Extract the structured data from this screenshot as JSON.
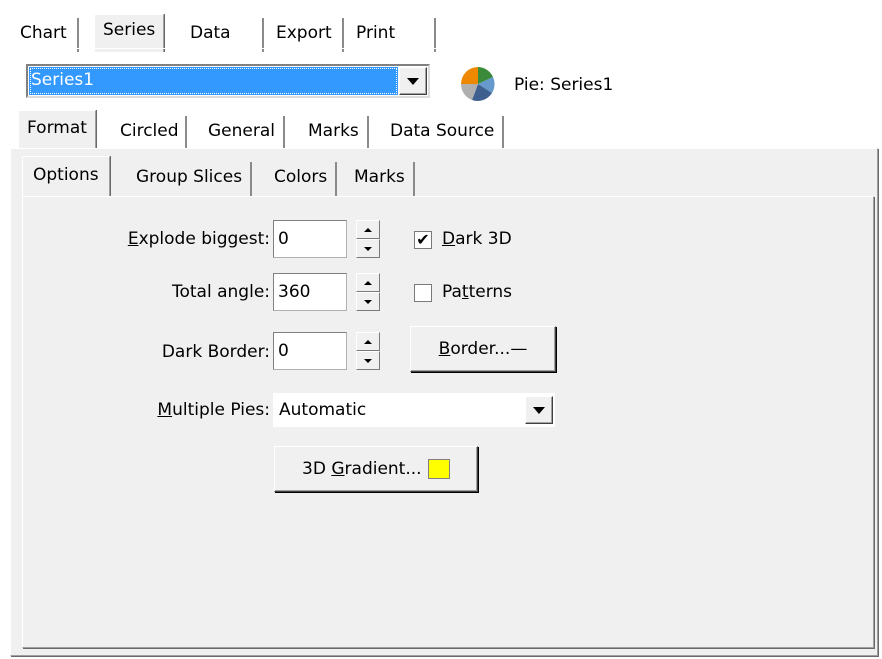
{
  "top_tabs": [
    "Chart",
    "Series",
    "Data",
    "Export",
    "Print"
  ],
  "active_top_tab": "Series",
  "series_select": {
    "value": "Series1"
  },
  "series_info": {
    "label": "Pie: Series1",
    "icon": "pie-chart-icon"
  },
  "series_tabs": [
    "Format",
    "Circled",
    "General",
    "Marks",
    "Data Source"
  ],
  "active_series_tab": "Format",
  "format_tabs": [
    "Options",
    "Group Slices",
    "Colors",
    "Marks"
  ],
  "active_format_tab": "Options",
  "options": {
    "explode_biggest": {
      "label_pre": "",
      "label_ul": "E",
      "label_post": "xplode biggest:",
      "value": "0"
    },
    "total_angle": {
      "label": "Total angle:",
      "value": "360"
    },
    "dark_border": {
      "label": "Dark Border:",
      "value": "0"
    },
    "dark_3d": {
      "label_pre": "",
      "label_ul": "D",
      "label_post": "ark 3D",
      "checked": true,
      "check_glyph": "✔"
    },
    "patterns": {
      "label_pre": "Pa",
      "label_ul": "t",
      "label_post": "terns",
      "checked": false
    },
    "border_button": {
      "label_pre": "",
      "label_ul": "B",
      "label_post": "order...",
      "suffix": "—"
    },
    "multiple_pies": {
      "label_pre": "",
      "label_ul": "M",
      "label_post": "ultiple Pies:",
      "value": "Automatic"
    },
    "gradient_button": {
      "label_pre": "3D ",
      "label_ul": "G",
      "label_post": "radient...",
      "swatch_color": "#ffff00"
    }
  }
}
